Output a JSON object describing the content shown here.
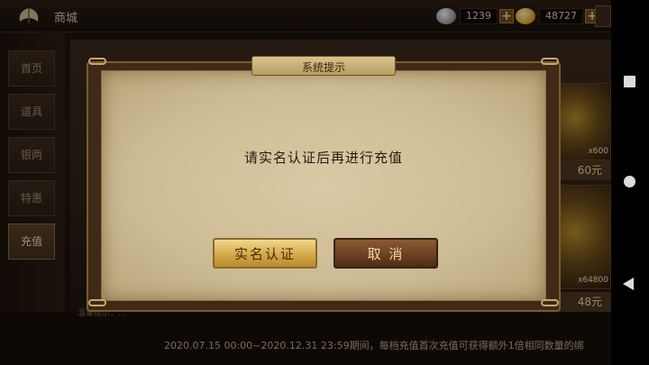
{
  "topbar": {
    "title": "商城",
    "logo_icon": "fan-leaf-icon",
    "currency1": {
      "icon": "silver-ingot-icon",
      "value": "1239"
    },
    "currency2": {
      "icon": "gold-ingot-icon",
      "value": "48727"
    },
    "plus_label": "+"
  },
  "nav": {
    "items": [
      {
        "label": "首页",
        "active": false
      },
      {
        "label": "道具",
        "active": false
      },
      {
        "label": "银两",
        "active": false
      },
      {
        "label": "特惠",
        "active": false
      },
      {
        "label": "充值",
        "active": true
      }
    ]
  },
  "shop": {
    "cards": [
      {
        "qty": "x600",
        "price": "60元"
      },
      {
        "qty": "x64800",
        "price": "48元"
      }
    ],
    "hint": "温馨提示：...",
    "notice": "2020.07.15 00:00~2020.12.31 23:59期间，每档充值首次充值可获得额外1倍相同数量的绑"
  },
  "dialog": {
    "title": "系统提示",
    "message": "请实名认证后再进行充值",
    "verify_label": "实名认证",
    "cancel_label": "取 消"
  },
  "system_nav": {
    "recents_icon": "square-icon",
    "home_icon": "circle-icon",
    "back_icon": "back-triangle-icon"
  },
  "colors": {
    "gold_button": "#d5a948",
    "brown_button": "#6a3f22",
    "paper": "#cdbb94"
  }
}
